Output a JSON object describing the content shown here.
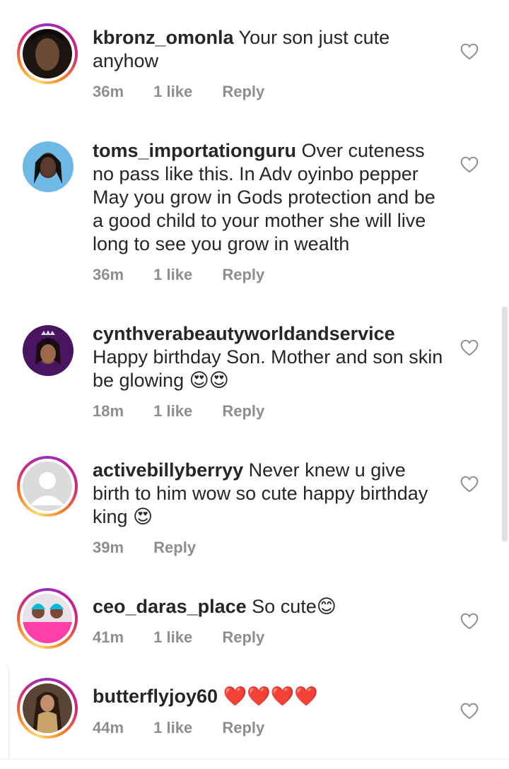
{
  "comments": [
    {
      "username": "kbronz_omonla",
      "text": "Your son just cute anyhow",
      "time": "36m",
      "likes": "1 like",
      "reply": "Reply"
    },
    {
      "username": "toms_importationguru",
      "text": "Over cuteness no pass like this. In Adv oyinbo pepper May you grow in Gods protection and be a good child to your mother she will live long to see you grow in wealth",
      "time": "36m",
      "likes": "1 like",
      "reply": "Reply"
    },
    {
      "username": "cynthverabeautyworldandservice",
      "text": "Happy birthday Son. Mother and son skin be glowing 😍😍",
      "time": "18m",
      "likes": "1 like",
      "reply": "Reply"
    },
    {
      "username": "activebillyberryy",
      "text": "Never knew u give birth to him wow so cute happy birthday king 😍",
      "time": "39m",
      "likes": "",
      "reply": "Reply"
    },
    {
      "username": "ceo_daras_place",
      "text": "So cute😊",
      "time": "41m",
      "likes": "1 like",
      "reply": "Reply"
    },
    {
      "username": "butterflyjoy60",
      "text": "❤️❤️❤️❤️",
      "time": "44m",
      "likes": "1 like",
      "reply": "Reply"
    }
  ],
  "icons": {
    "like": "heart-outline-icon"
  },
  "colors": {
    "meta": "#8e8e8e",
    "text": "#262626",
    "ring_start": "#feda75",
    "ring_end": "#962fbf"
  }
}
